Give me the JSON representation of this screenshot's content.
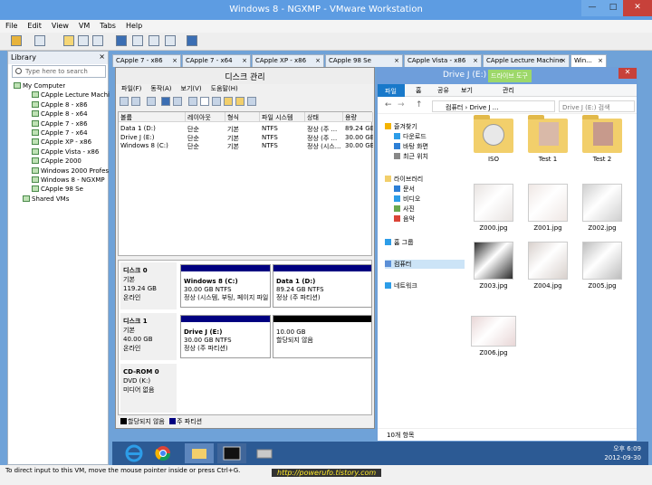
{
  "window": {
    "title": "Windows 8 - NGXMP - VMware Workstation"
  },
  "menu": [
    "File",
    "Edit",
    "View",
    "VM",
    "Tabs",
    "Help"
  ],
  "library": {
    "header": "Library",
    "search_placeholder": "Type here to search",
    "items": [
      {
        "label": "My Computer",
        "level": 0
      },
      {
        "label": "CApple Lecture Machi",
        "level": 2
      },
      {
        "label": "CApple 8 - x86",
        "level": 2
      },
      {
        "label": "CApple 8 - x64",
        "level": 2
      },
      {
        "label": "CApple 7 - x86",
        "level": 2
      },
      {
        "label": "CApple 7 - x64",
        "level": 2
      },
      {
        "label": "CApple XP - x86",
        "level": 2
      },
      {
        "label": "CApple Vista - x86",
        "level": 2
      },
      {
        "label": "CApple 2000",
        "level": 2
      },
      {
        "label": "Windows 2000 Profes",
        "level": 2
      },
      {
        "label": "Windows 8 - NGXMP",
        "level": 2
      },
      {
        "label": "CApple 98 Se",
        "level": 2
      },
      {
        "label": "Shared VMs",
        "level": 1
      }
    ]
  },
  "tabs": [
    {
      "label": "CApple 7 - x86"
    },
    {
      "label": "CApple 7 - x64"
    },
    {
      "label": "CApple XP - x86"
    },
    {
      "label": "CApple 98 Se"
    },
    {
      "label": "CApple Vista - x86"
    },
    {
      "label": "CApple Lecture Machine"
    },
    {
      "label": "Win..."
    }
  ],
  "disk_mgmt": {
    "title": "디스크 관리",
    "menu": [
      "파일(F)",
      "동작(A)",
      "보기(V)",
      "도움말(H)"
    ],
    "columns": [
      "볼륨",
      "레이아웃",
      "형식",
      "파일 시스템",
      "상태",
      "용량"
    ],
    "rows": [
      [
        "Data 1 (D:)",
        "단순",
        "기본",
        "NTFS",
        "정상 (주 ...",
        "89.24 GB"
      ],
      [
        "Drive J (E:)",
        "단순",
        "기본",
        "NTFS",
        "정상 (주 ...",
        "30.00 GB"
      ],
      [
        "Windows 8 (C:)",
        "단순",
        "기본",
        "NTFS",
        "정상 (시스...",
        "30.00 GB"
      ]
    ],
    "disks": [
      {
        "name": "디스크 0",
        "type": "기본",
        "size": "119.24 GB",
        "state": "온라인",
        "parts": [
          {
            "name": "Windows 8  (C:)",
            "size": "30.00 GB NTFS",
            "status": "정상 (시스템, 부팅, 페이지 파일"
          },
          {
            "name": "Data 1  (D:)",
            "size": "89.24 GB NTFS",
            "status": "정상 (주 파티션)"
          }
        ]
      },
      {
        "name": "디스크 1",
        "type": "기본",
        "size": "40.00 GB",
        "state": "온라인",
        "parts": [
          {
            "name": "Drive J  (E:)",
            "size": "30.00 GB NTFS",
            "status": "정상 (주 파티션)"
          },
          {
            "name": "",
            "size": "10.00 GB",
            "status": "할당되지 않음"
          }
        ]
      },
      {
        "name": "CD-ROM 0",
        "type": "DVD (K:)",
        "size": "",
        "state": "미디어 없음",
        "parts": []
      }
    ],
    "legend": [
      "할당되지 않음",
      "주 파티션"
    ]
  },
  "explorer": {
    "title": "Drive J (E:)",
    "drive_tools": "드라이브 도구",
    "ribbon": [
      "파일",
      "홈",
      "공유",
      "보기",
      "관리"
    ],
    "address": "컴퓨터  ›  Drive J ...",
    "search_placeholder": "Drive J (E:) 검색",
    "nav": [
      {
        "label": "즐겨찾기",
        "group": true
      },
      {
        "label": "다운로드"
      },
      {
        "label": "바탕 화면"
      },
      {
        "label": "최근 위치"
      },
      {
        "label": "라이브러리",
        "group": true
      },
      {
        "label": "문서"
      },
      {
        "label": "비디오"
      },
      {
        "label": "사진"
      },
      {
        "label": "음악"
      },
      {
        "label": "홈 그룹",
        "group": true
      },
      {
        "label": "컴퓨터",
        "group": true
      },
      {
        "label": "네트워크",
        "group": true
      }
    ],
    "files": [
      "ISO",
      "Test 1",
      "Test 2",
      "Z000.jpg",
      "Z001.jpg",
      "Z002.jpg",
      "Z003.jpg",
      "Z004.jpg",
      "Z005.jpg",
      "Z006.jpg"
    ],
    "status": "10개 항목"
  },
  "taskbar": {
    "time": "오후 6:09",
    "date": "2012-09-30"
  },
  "statusbar": {
    "message": "To direct input to this VM, move the mouse pointer inside or press Ctrl+G.",
    "url": "http://powerufo.tistory.com"
  },
  "colors": {
    "unallocated": "#000000",
    "primary": "#000080",
    "accent": "#1979ca"
  }
}
